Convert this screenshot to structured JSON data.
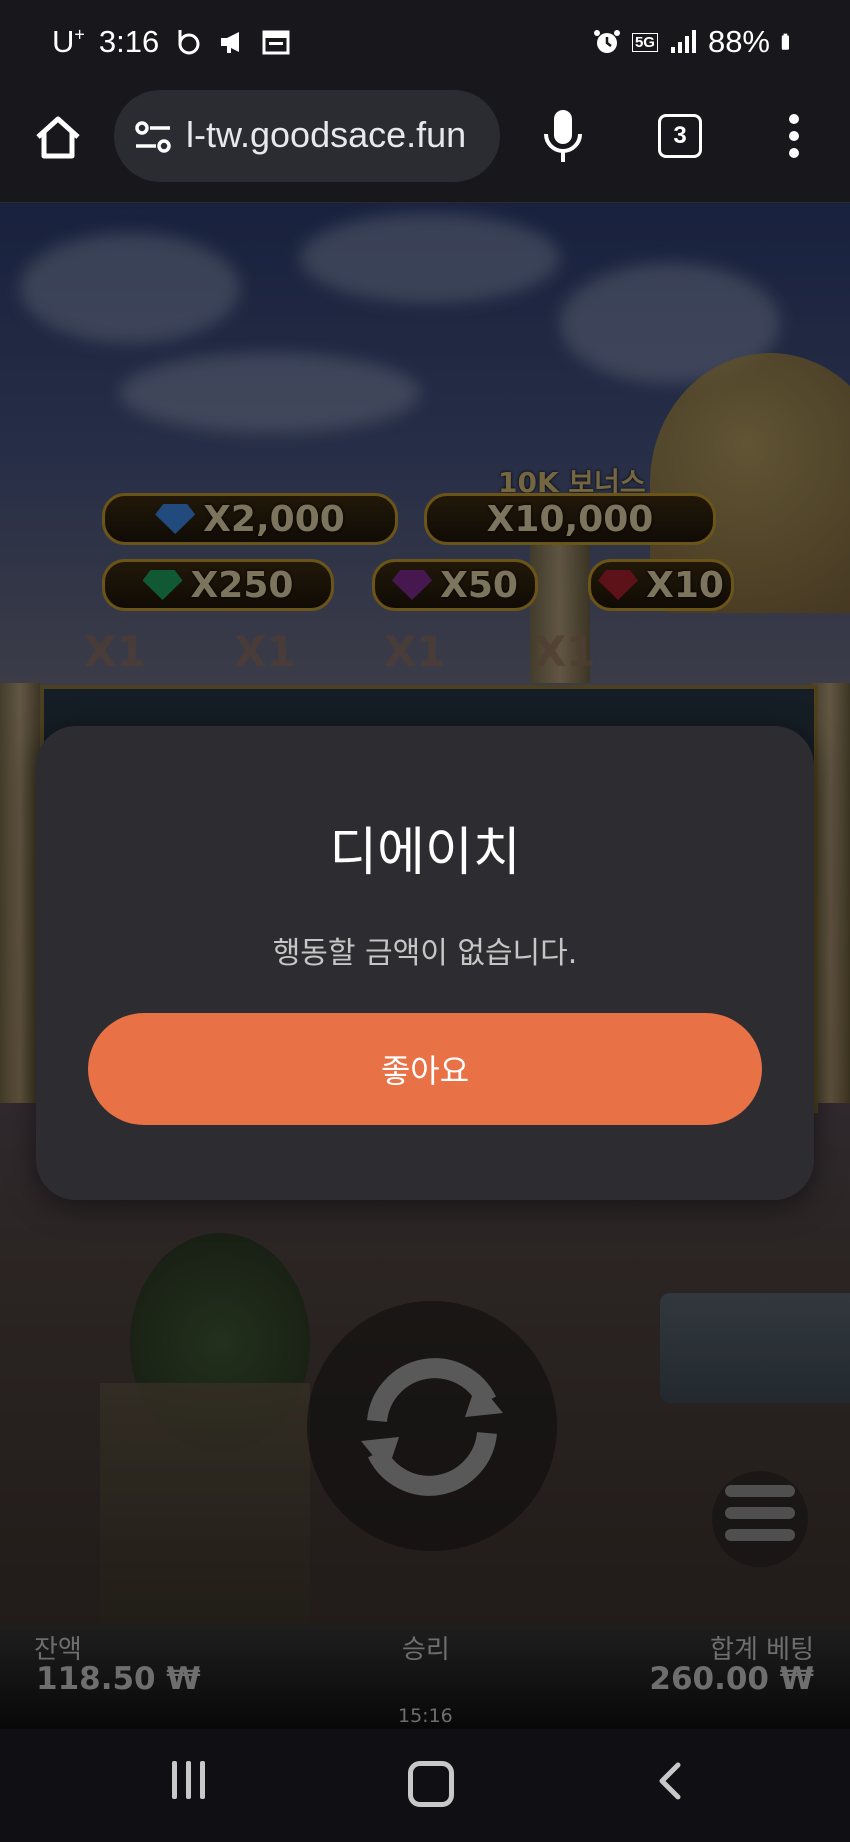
{
  "status_bar": {
    "carrier": "U",
    "carrier_sup": "+",
    "time": "3:16",
    "network": "5G",
    "battery": "88%",
    "icons": [
      "b-app-icon",
      "megaphone-icon",
      "calendar-icon",
      "alarm-icon",
      "signal-icon",
      "battery-icon"
    ]
  },
  "browser": {
    "url": "l-tw.goodsace.fun",
    "tab_count": "3",
    "icons": [
      "home-icon",
      "site-settings-icon",
      "mic-icon",
      "more-vert-icon"
    ]
  },
  "game": {
    "jackpots": [
      {
        "label": "X2,000",
        "gem": "blue"
      },
      {
        "label": "X10,000",
        "gem": "none"
      },
      {
        "label": "X250",
        "gem": "green"
      },
      {
        "label": "X50",
        "gem": "purple"
      },
      {
        "label": "X10",
        "gem": "red"
      }
    ],
    "bonus_label": "10K 보너스",
    "multipliers": [
      "X1",
      "X1",
      "X1",
      "X1"
    ],
    "colors": {
      "blue": "#3a80d8",
      "green": "#1e9a5a",
      "purple": "#7a2a8a",
      "red": "#a01e2a"
    }
  },
  "info_bar": {
    "balance_label": "잔액",
    "balance_value": "118.50 ₩",
    "win_label": "승리",
    "total_bet_label": "합계 베팅",
    "total_bet_value": "260.00 ₩",
    "clock": "15:16"
  },
  "dialog": {
    "title": "디에이치",
    "message": "행동할 금액이 없습니다.",
    "ok_label": "좋아요",
    "accent": "#e87146"
  },
  "nav_bar": {
    "icons": [
      "recents-icon",
      "home-nav-icon",
      "back-icon"
    ]
  }
}
